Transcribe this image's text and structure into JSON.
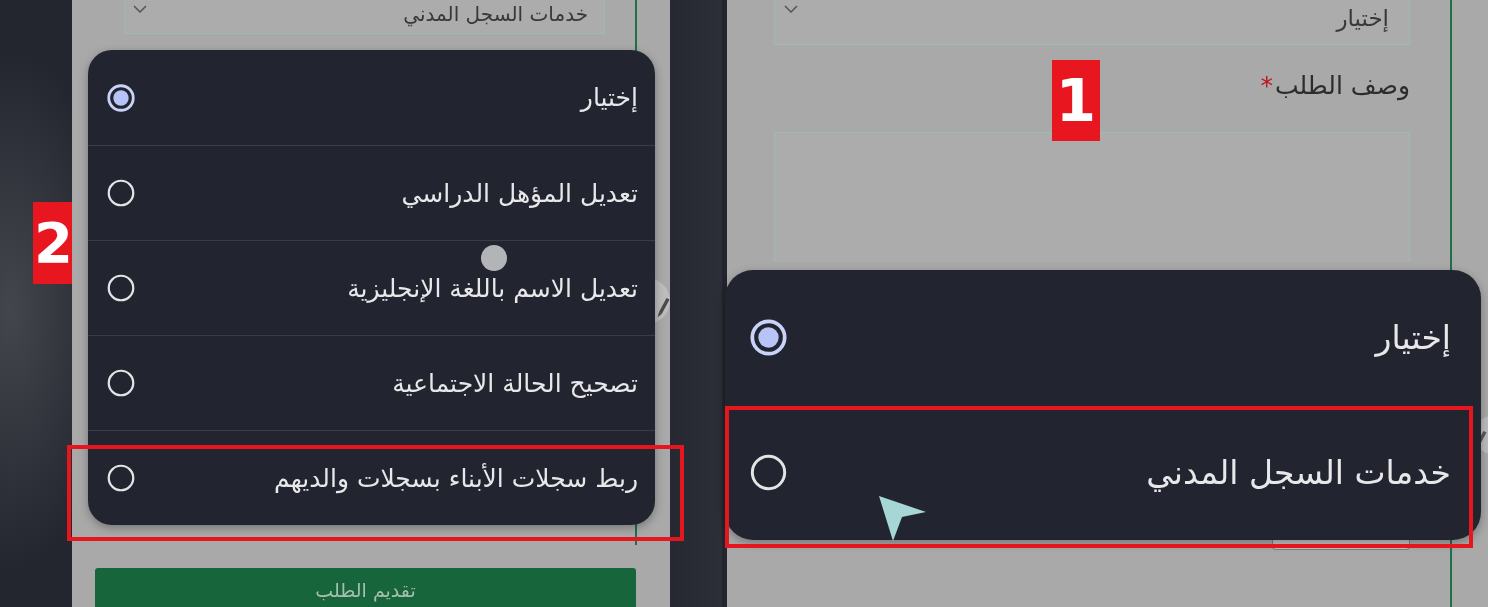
{
  "left_screen": {
    "service_select": {
      "value": "خدمات السجل المدني"
    },
    "badge": "2",
    "request_type_menu": {
      "options": [
        {
          "label": "إختيار",
          "selected": true,
          "highlighted": false
        },
        {
          "label": "تعديل المؤهل الدراسي",
          "selected": false,
          "highlighted": false
        },
        {
          "label": "تعديل الاسم باللغة الإنجليزية",
          "selected": false,
          "highlighted": false
        },
        {
          "label": "تصحيح الحالة الاجتماعية",
          "selected": false,
          "highlighted": false
        },
        {
          "label": "ربط سجلات الأبناء بسجلات والديهم",
          "selected": false,
          "highlighted": true
        }
      ]
    },
    "submit_button": "تقديم الطلب"
  },
  "right_screen": {
    "service_select": {
      "value": "إختيار"
    },
    "description_label": "وصف الطلب",
    "required_mark": "*",
    "badge": "1",
    "service_menu": {
      "options": [
        {
          "label": "إختيار",
          "selected": true,
          "highlighted": false
        },
        {
          "label": "خدمات السجل المدني",
          "selected": false,
          "highlighted": true
        }
      ]
    }
  }
}
